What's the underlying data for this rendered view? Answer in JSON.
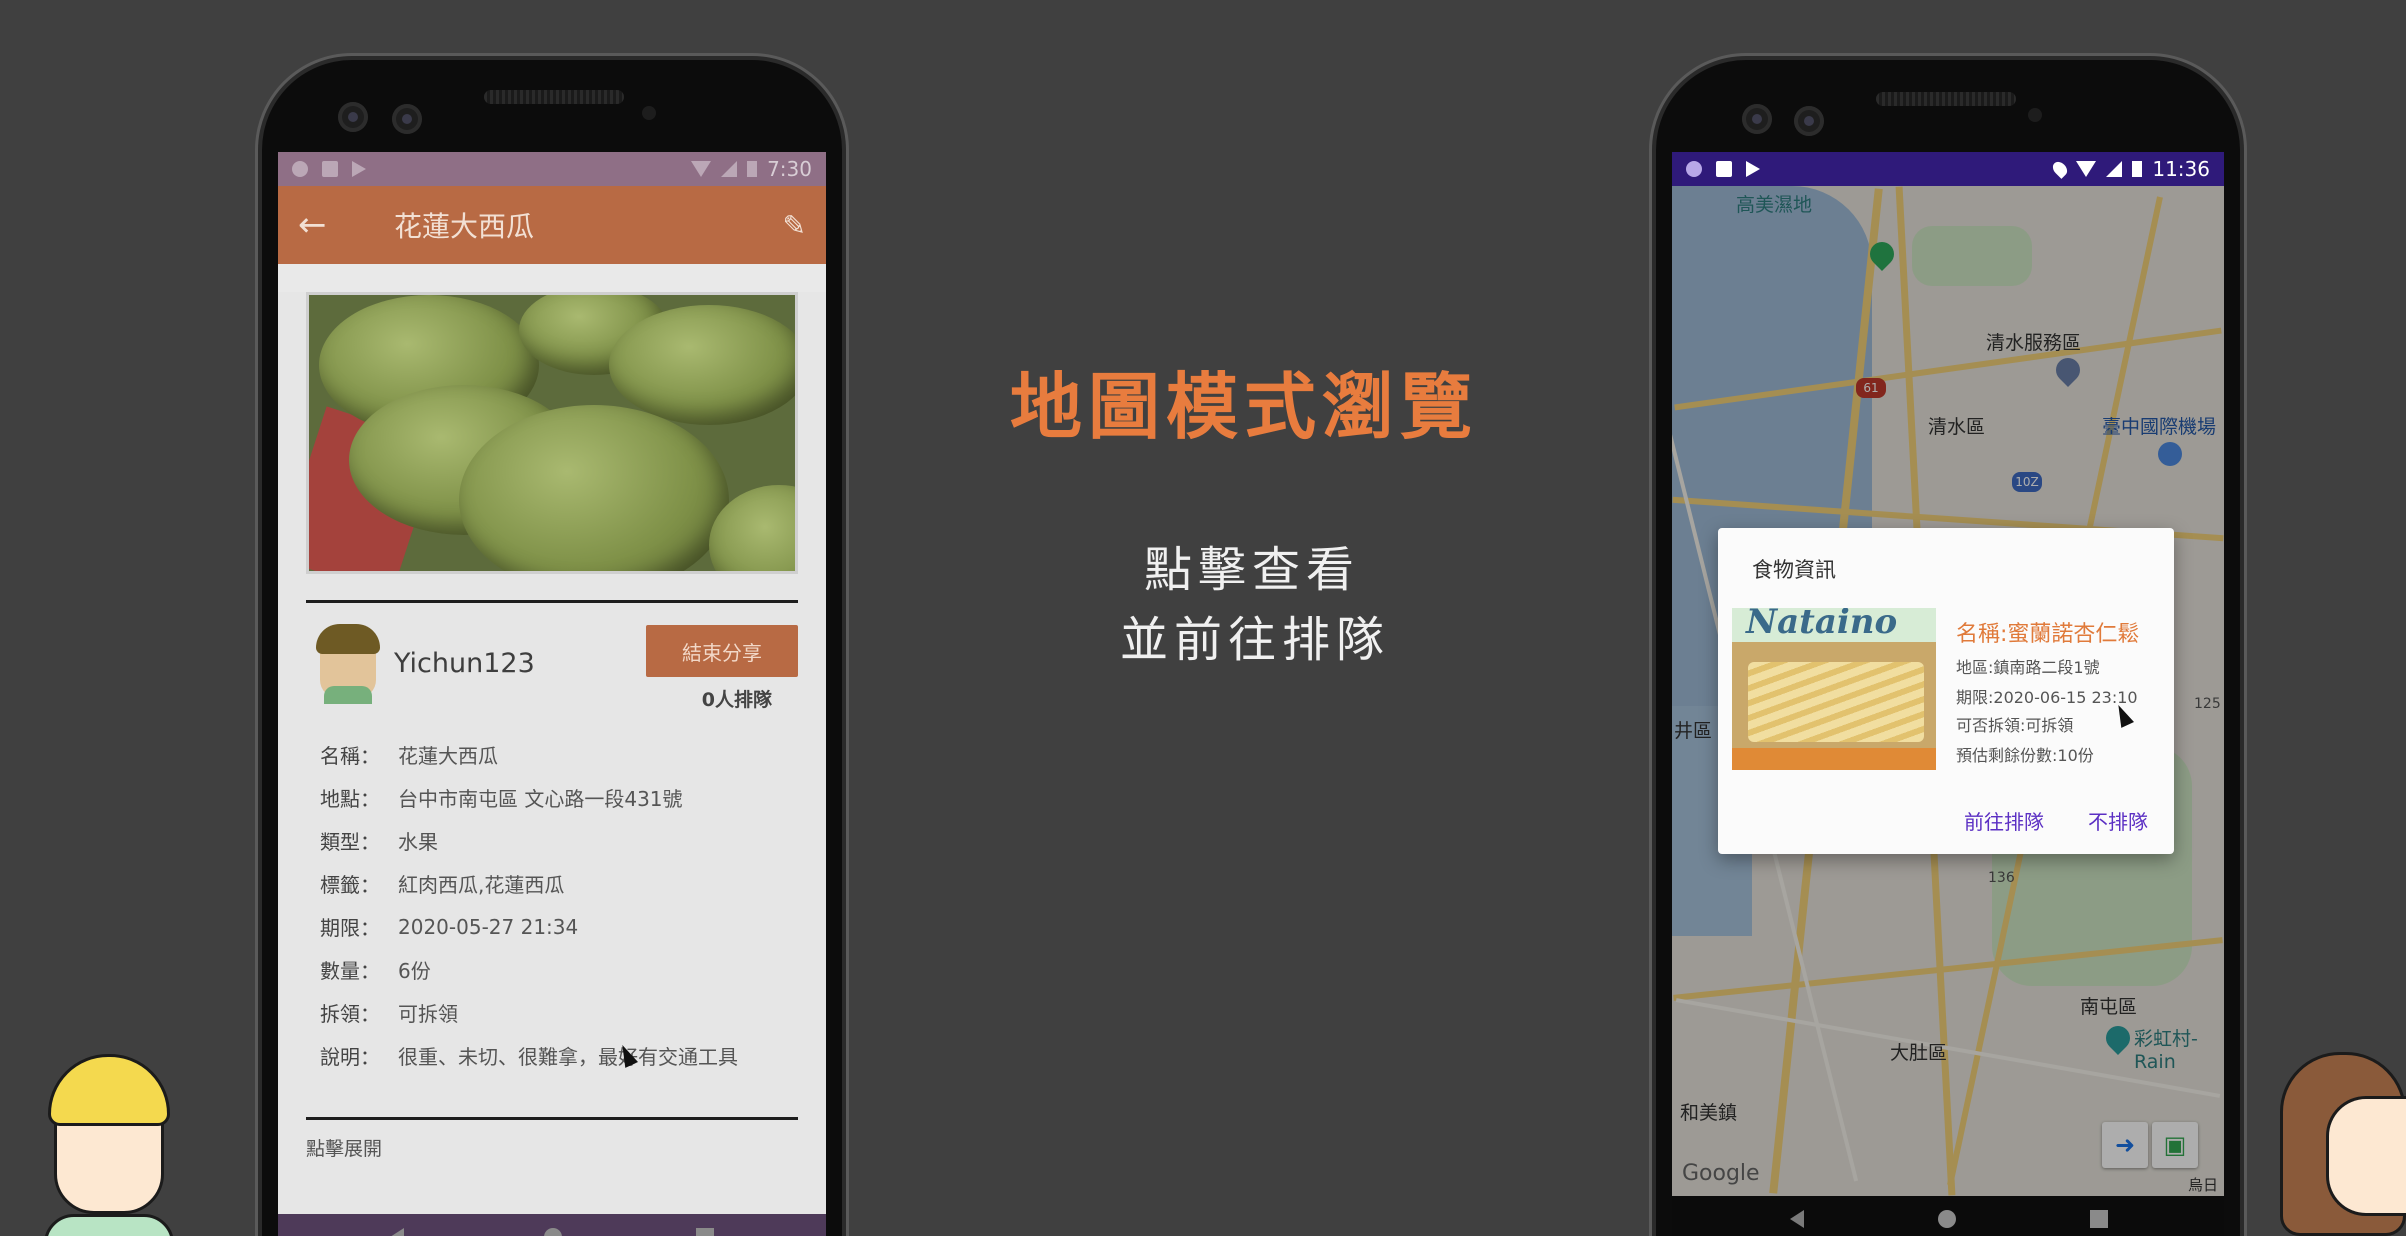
{
  "center": {
    "headline": "地圖模式瀏覽",
    "sub_line1": "點擊查看",
    "sub_line2": "並前往排隊"
  },
  "left_phone": {
    "status_time": "7:30",
    "appbar": {
      "back_icon": "arrow-back-icon",
      "title": "花蓮大西瓜",
      "edit_icon": "pencil-icon"
    },
    "user": {
      "name": "Yichun123",
      "end_share_button": "結束分享",
      "queue_count": "0人排隊"
    },
    "details": [
      {
        "label": "名稱：",
        "value": "花蓮大西瓜"
      },
      {
        "label": "地點：",
        "value": "台中市南屯區 文心路一段431號"
      },
      {
        "label": "類型：",
        "value": "水果"
      },
      {
        "label": "標籤：",
        "value": "紅肉西瓜,花蓮西瓜"
      },
      {
        "label": "期限：",
        "value": "2020-05-27 21:34"
      },
      {
        "label": "數量：",
        "value": "6份"
      },
      {
        "label": "拆領：",
        "value": "可拆領"
      },
      {
        "label": "說明：",
        "value": "很重、未切、很難拿，最好有交通工具"
      }
    ],
    "expand_link": "點擊展開"
  },
  "right_phone": {
    "status_time": "11:36",
    "map_labels": {
      "l1": "高美濕地",
      "l2": "清水服務區",
      "l3": "清水區",
      "l4": "臺中國際機場",
      "l5": "井區",
      "l6": "南屯區",
      "l7": "大肚區",
      "l8": "和美鎮",
      "l9": "彩虹村-Rain",
      "l10": "烏日",
      "google": "Google"
    },
    "map_numbers": {
      "n1": "61",
      "n2": "125",
      "n3": "136",
      "n4": "10Z"
    },
    "dialog": {
      "title": "食物資訊",
      "image_brand": "Nataino",
      "name": "名稱:蜜蘭諾杏仁鬆",
      "location": "地區:鎮南路二段1號",
      "deadline": "期限:2020-06-15 23:10",
      "split": "可否拆領:可拆領",
      "remaining": "預估剩餘份數:10份",
      "go_button": "前往排隊",
      "cancel_button": "不排隊"
    }
  },
  "colors": {
    "accent": "#e87c3e",
    "appbar": "#b86a44",
    "dialog_button": "#5b2fc3",
    "right_status": "#2f1a7a"
  }
}
